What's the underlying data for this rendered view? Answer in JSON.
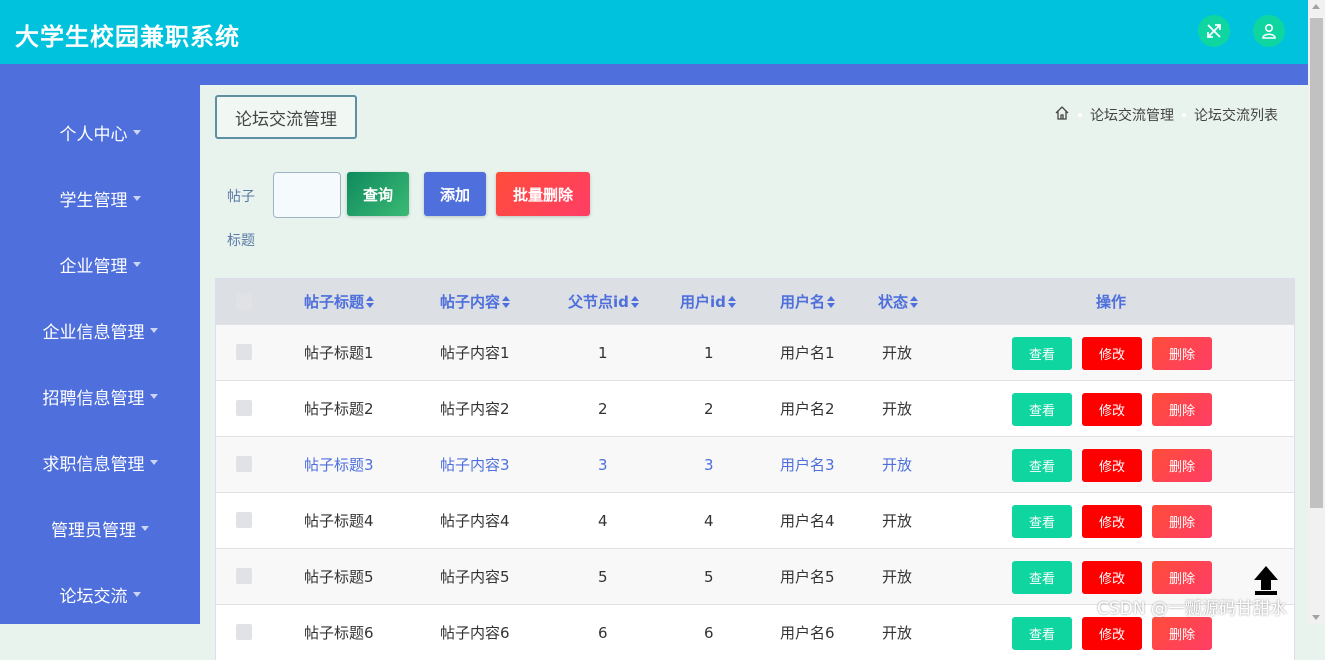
{
  "header": {
    "title": "大学生校园兼职系统",
    "bg_color": "#00c2dc",
    "icons": [
      "shuffle-icon",
      "user-icon"
    ]
  },
  "sidebar": {
    "bg_color": "#4e6fdc",
    "items": [
      {
        "label": "个人中心"
      },
      {
        "label": "学生管理"
      },
      {
        "label": "企业管理"
      },
      {
        "label": "企业信息管理"
      },
      {
        "label": "招聘信息管理"
      },
      {
        "label": "求职信息管理"
      },
      {
        "label": "管理员管理"
      },
      {
        "label": "论坛交流"
      }
    ]
  },
  "page": {
    "section_title": "论坛交流管理",
    "breadcrumb": [
      "论坛交流管理",
      "论坛交流列表"
    ]
  },
  "search": {
    "label_line1": "帖子",
    "label_line2": "标题",
    "value": "",
    "query_label": "查询",
    "add_label": "添加",
    "batch_delete_label": "批量删除"
  },
  "table": {
    "columns": [
      "帖子标题",
      "帖子内容",
      "父节点id",
      "用户id",
      "用户名",
      "状态",
      "操作"
    ],
    "rows": [
      {
        "title": "帖子标题1",
        "content": "帖子内容1",
        "parent_id": "1",
        "user_id": "1",
        "username": "用户名1",
        "status": "开放"
      },
      {
        "title": "帖子标题2",
        "content": "帖子内容2",
        "parent_id": "2",
        "user_id": "2",
        "username": "用户名2",
        "status": "开放"
      },
      {
        "title": "帖子标题3",
        "content": "帖子内容3",
        "parent_id": "3",
        "user_id": "3",
        "username": "用户名3",
        "status": "开放"
      },
      {
        "title": "帖子标题4",
        "content": "帖子内容4",
        "parent_id": "4",
        "user_id": "4",
        "username": "用户名4",
        "status": "开放"
      },
      {
        "title": "帖子标题5",
        "content": "帖子内容5",
        "parent_id": "5",
        "user_id": "5",
        "username": "用户名5",
        "status": "开放"
      },
      {
        "title": "帖子标题6",
        "content": "帖子内容6",
        "parent_id": "6",
        "user_id": "6",
        "username": "用户名6",
        "status": "开放"
      }
    ],
    "actions": {
      "view": "查看",
      "edit": "修改",
      "delete": "删除"
    }
  },
  "watermark": "CSDN @一瓢源码甘甜水"
}
